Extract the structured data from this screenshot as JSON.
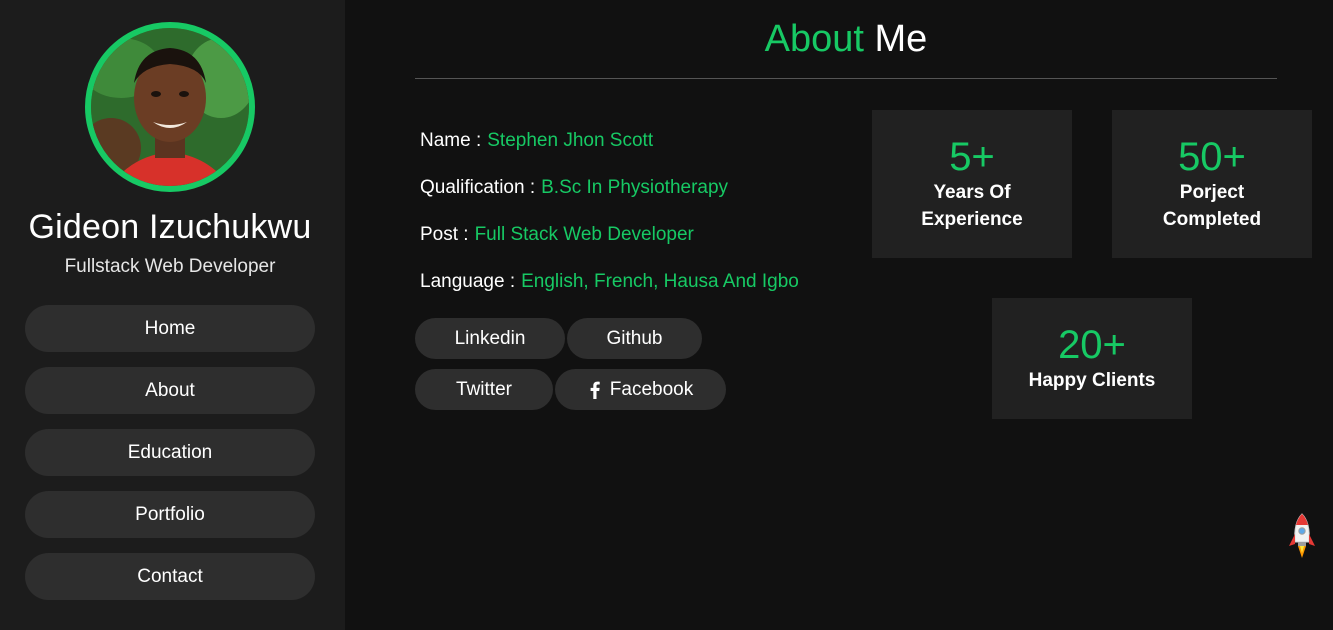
{
  "profile": {
    "name": "Gideon Izuchukwu",
    "role": "Fullstack Web Developer"
  },
  "nav": [
    {
      "label": "Home"
    },
    {
      "label": "About"
    },
    {
      "label": "Education"
    },
    {
      "label": "Portfolio"
    },
    {
      "label": "Contact"
    }
  ],
  "about": {
    "title_accent": "About",
    "title_rest": "Me"
  },
  "info": [
    {
      "label": "Name :",
      "value": "Stephen Jhon Scott"
    },
    {
      "label": "Qualification :",
      "value": "B.Sc In Physiotherapy"
    },
    {
      "label": "Post :",
      "value": "Full Stack Web Developer"
    },
    {
      "label": "Language :",
      "value": "English, French, Hausa And Igbo"
    }
  ],
  "socials": [
    {
      "label": "Linkedin"
    },
    {
      "label": "Github"
    },
    {
      "label": "Twitter"
    },
    {
      "label": "Facebook"
    }
  ],
  "stats": [
    {
      "value": "5+",
      "label_line1": "Years Of",
      "label_line2": "Experience"
    },
    {
      "value": "50+",
      "label_line1": "Porject",
      "label_line2": "Completed"
    },
    {
      "value": "20+",
      "label_line1": "Happy Clients"
    }
  ],
  "colors": {
    "accent": "#17c964",
    "background": "#111111",
    "sidebar": "#1c1c1c",
    "button": "#2e2e2e",
    "card": "#212121"
  },
  "icons": {
    "facebook": "facebook-icon",
    "scroll_top": "rocket-icon"
  }
}
